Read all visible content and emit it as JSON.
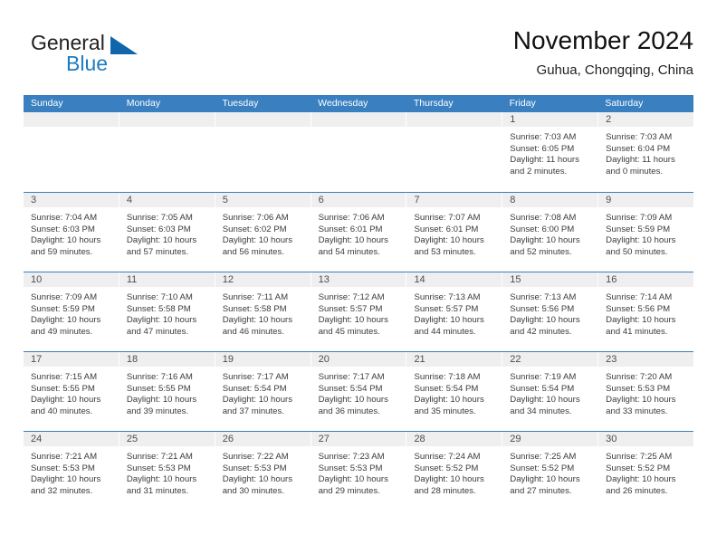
{
  "brand": {
    "name_top": "General",
    "name_bottom": "Blue",
    "accent_color": "#1166ab",
    "text_color": "#231f20"
  },
  "header": {
    "title": "November 2024",
    "location": "Guhua, Chongqing, China"
  },
  "calendar": {
    "header_bg": "#3a80c1",
    "daynum_bg": "#efefef",
    "weekdays": [
      "Sunday",
      "Monday",
      "Tuesday",
      "Wednesday",
      "Thursday",
      "Friday",
      "Saturday"
    ],
    "weeks": [
      [
        {
          "day": "",
          "lines": []
        },
        {
          "day": "",
          "lines": []
        },
        {
          "day": "",
          "lines": []
        },
        {
          "day": "",
          "lines": []
        },
        {
          "day": "",
          "lines": []
        },
        {
          "day": "1",
          "lines": [
            "Sunrise: 7:03 AM",
            "Sunset: 6:05 PM",
            "Daylight: 11 hours",
            "and 2 minutes."
          ]
        },
        {
          "day": "2",
          "lines": [
            "Sunrise: 7:03 AM",
            "Sunset: 6:04 PM",
            "Daylight: 11 hours",
            "and 0 minutes."
          ]
        }
      ],
      [
        {
          "day": "3",
          "lines": [
            "Sunrise: 7:04 AM",
            "Sunset: 6:03 PM",
            "Daylight: 10 hours",
            "and 59 minutes."
          ]
        },
        {
          "day": "4",
          "lines": [
            "Sunrise: 7:05 AM",
            "Sunset: 6:03 PM",
            "Daylight: 10 hours",
            "and 57 minutes."
          ]
        },
        {
          "day": "5",
          "lines": [
            "Sunrise: 7:06 AM",
            "Sunset: 6:02 PM",
            "Daylight: 10 hours",
            "and 56 minutes."
          ]
        },
        {
          "day": "6",
          "lines": [
            "Sunrise: 7:06 AM",
            "Sunset: 6:01 PM",
            "Daylight: 10 hours",
            "and 54 minutes."
          ]
        },
        {
          "day": "7",
          "lines": [
            "Sunrise: 7:07 AM",
            "Sunset: 6:01 PM",
            "Daylight: 10 hours",
            "and 53 minutes."
          ]
        },
        {
          "day": "8",
          "lines": [
            "Sunrise: 7:08 AM",
            "Sunset: 6:00 PM",
            "Daylight: 10 hours",
            "and 52 minutes."
          ]
        },
        {
          "day": "9",
          "lines": [
            "Sunrise: 7:09 AM",
            "Sunset: 5:59 PM",
            "Daylight: 10 hours",
            "and 50 minutes."
          ]
        }
      ],
      [
        {
          "day": "10",
          "lines": [
            "Sunrise: 7:09 AM",
            "Sunset: 5:59 PM",
            "Daylight: 10 hours",
            "and 49 minutes."
          ]
        },
        {
          "day": "11",
          "lines": [
            "Sunrise: 7:10 AM",
            "Sunset: 5:58 PM",
            "Daylight: 10 hours",
            "and 47 minutes."
          ]
        },
        {
          "day": "12",
          "lines": [
            "Sunrise: 7:11 AM",
            "Sunset: 5:58 PM",
            "Daylight: 10 hours",
            "and 46 minutes."
          ]
        },
        {
          "day": "13",
          "lines": [
            "Sunrise: 7:12 AM",
            "Sunset: 5:57 PM",
            "Daylight: 10 hours",
            "and 45 minutes."
          ]
        },
        {
          "day": "14",
          "lines": [
            "Sunrise: 7:13 AM",
            "Sunset: 5:57 PM",
            "Daylight: 10 hours",
            "and 44 minutes."
          ]
        },
        {
          "day": "15",
          "lines": [
            "Sunrise: 7:13 AM",
            "Sunset: 5:56 PM",
            "Daylight: 10 hours",
            "and 42 minutes."
          ]
        },
        {
          "day": "16",
          "lines": [
            "Sunrise: 7:14 AM",
            "Sunset: 5:56 PM",
            "Daylight: 10 hours",
            "and 41 minutes."
          ]
        }
      ],
      [
        {
          "day": "17",
          "lines": [
            "Sunrise: 7:15 AM",
            "Sunset: 5:55 PM",
            "Daylight: 10 hours",
            "and 40 minutes."
          ]
        },
        {
          "day": "18",
          "lines": [
            "Sunrise: 7:16 AM",
            "Sunset: 5:55 PM",
            "Daylight: 10 hours",
            "and 39 minutes."
          ]
        },
        {
          "day": "19",
          "lines": [
            "Sunrise: 7:17 AM",
            "Sunset: 5:54 PM",
            "Daylight: 10 hours",
            "and 37 minutes."
          ]
        },
        {
          "day": "20",
          "lines": [
            "Sunrise: 7:17 AM",
            "Sunset: 5:54 PM",
            "Daylight: 10 hours",
            "and 36 minutes."
          ]
        },
        {
          "day": "21",
          "lines": [
            "Sunrise: 7:18 AM",
            "Sunset: 5:54 PM",
            "Daylight: 10 hours",
            "and 35 minutes."
          ]
        },
        {
          "day": "22",
          "lines": [
            "Sunrise: 7:19 AM",
            "Sunset: 5:54 PM",
            "Daylight: 10 hours",
            "and 34 minutes."
          ]
        },
        {
          "day": "23",
          "lines": [
            "Sunrise: 7:20 AM",
            "Sunset: 5:53 PM",
            "Daylight: 10 hours",
            "and 33 minutes."
          ]
        }
      ],
      [
        {
          "day": "24",
          "lines": [
            "Sunrise: 7:21 AM",
            "Sunset: 5:53 PM",
            "Daylight: 10 hours",
            "and 32 minutes."
          ]
        },
        {
          "day": "25",
          "lines": [
            "Sunrise: 7:21 AM",
            "Sunset: 5:53 PM",
            "Daylight: 10 hours",
            "and 31 minutes."
          ]
        },
        {
          "day": "26",
          "lines": [
            "Sunrise: 7:22 AM",
            "Sunset: 5:53 PM",
            "Daylight: 10 hours",
            "and 30 minutes."
          ]
        },
        {
          "day": "27",
          "lines": [
            "Sunrise: 7:23 AM",
            "Sunset: 5:53 PM",
            "Daylight: 10 hours",
            "and 29 minutes."
          ]
        },
        {
          "day": "28",
          "lines": [
            "Sunrise: 7:24 AM",
            "Sunset: 5:52 PM",
            "Daylight: 10 hours",
            "and 28 minutes."
          ]
        },
        {
          "day": "29",
          "lines": [
            "Sunrise: 7:25 AM",
            "Sunset: 5:52 PM",
            "Daylight: 10 hours",
            "and 27 minutes."
          ]
        },
        {
          "day": "30",
          "lines": [
            "Sunrise: 7:25 AM",
            "Sunset: 5:52 PM",
            "Daylight: 10 hours",
            "and 26 minutes."
          ]
        }
      ]
    ]
  }
}
